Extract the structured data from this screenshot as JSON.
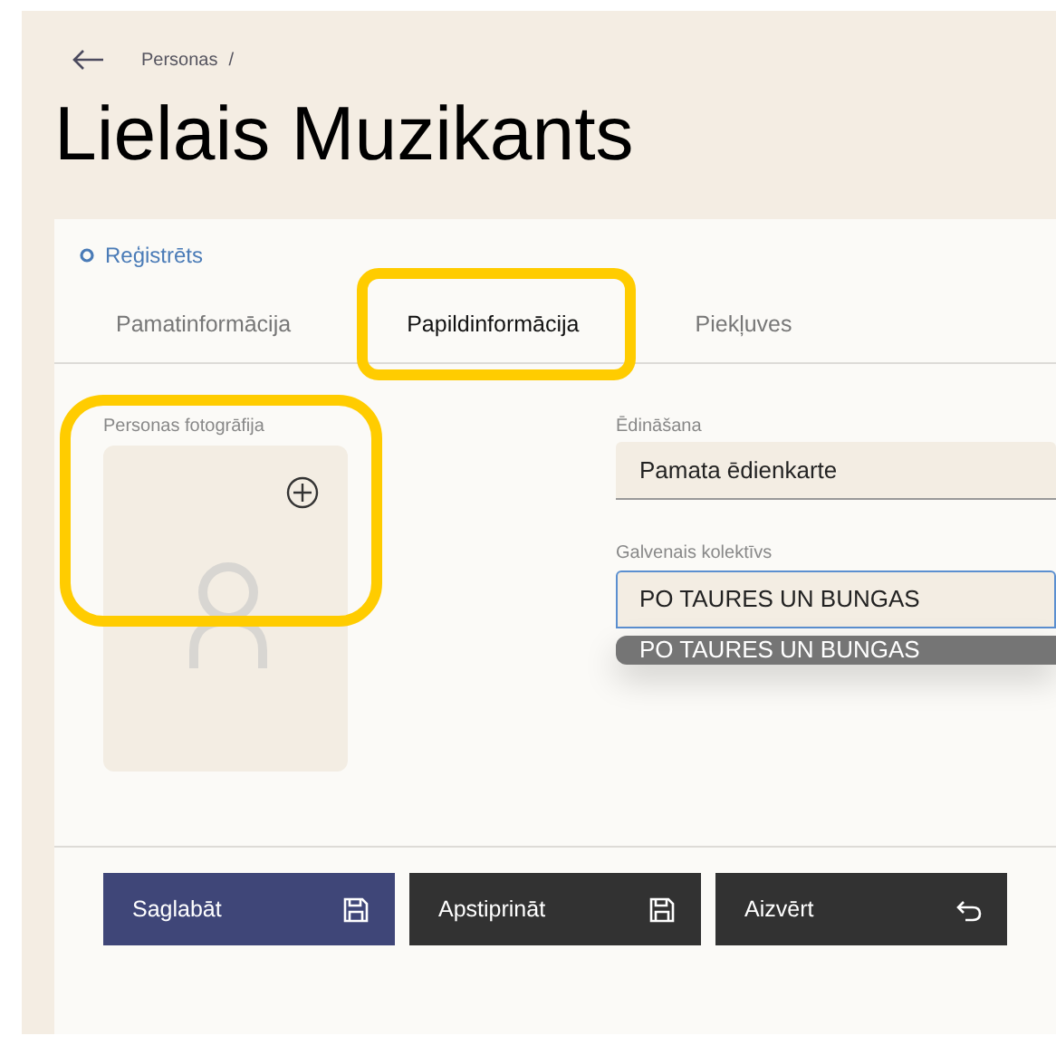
{
  "breadcrumb": {
    "items": [
      "Personas"
    ],
    "separator": "/"
  },
  "title": "Lielais Muzikants",
  "status": {
    "label": "Reģistrēts"
  },
  "tabs": [
    {
      "label": "Pamatinformācija",
      "selected": false,
      "highlighted": false
    },
    {
      "label": "Papildinformācija",
      "selected": true,
      "highlighted": true
    },
    {
      "label": "Piekļuves",
      "selected": false,
      "highlighted": false
    }
  ],
  "photo": {
    "label": "Personas fotogrāfija",
    "highlighted": true
  },
  "fields": [
    {
      "label": "Ēdināšana",
      "value": "Pamata ēdienkarte",
      "focused": false
    },
    {
      "label": "Galvenais kolektīvs",
      "value": "PO TAURES UN BUNGAS",
      "focused": true,
      "options": [
        {
          "label": "PO TAURES UN BUNGAS",
          "selected": true
        }
      ]
    }
  ],
  "buttons": [
    {
      "label": "Saglabāt",
      "kind": "save"
    },
    {
      "label": "Apstiprināt",
      "kind": "confirm"
    },
    {
      "label": "Aizvērt",
      "kind": "close"
    }
  ]
}
